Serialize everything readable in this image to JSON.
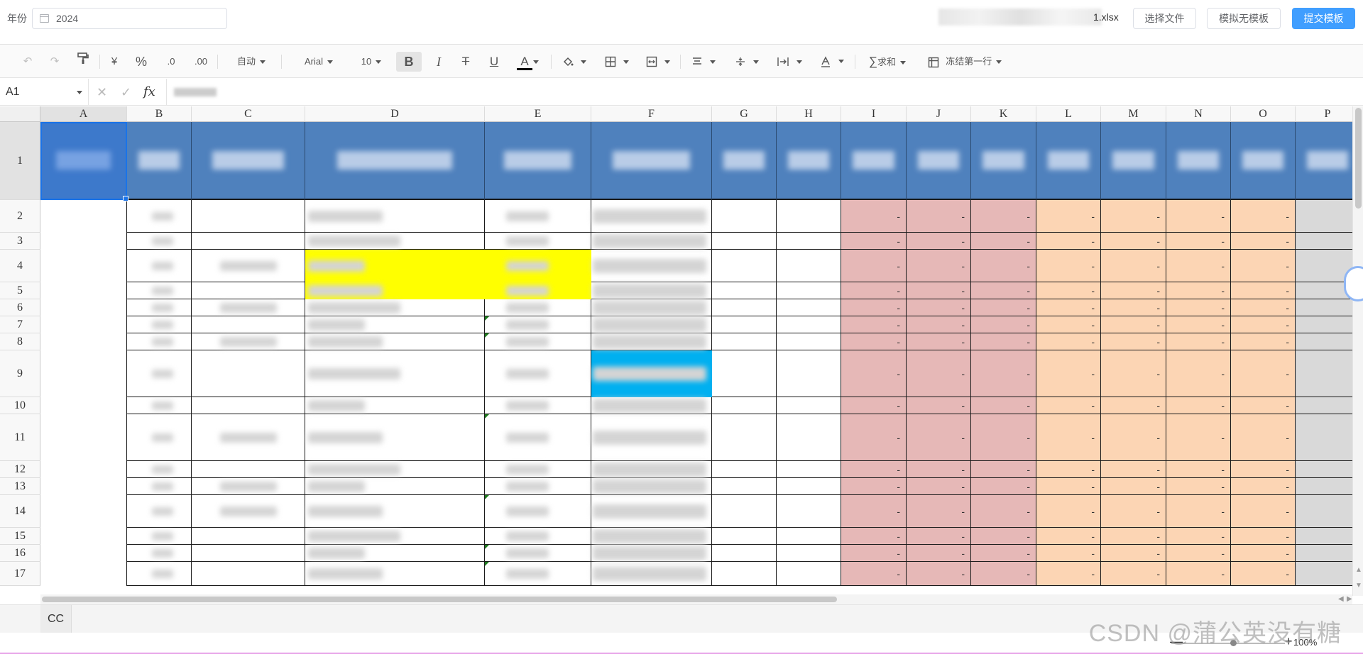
{
  "header": {
    "year_label": "年份",
    "year_value": "2024",
    "filename": "1.xlsx",
    "select_file": "选择文件",
    "download_template": "模拟无模板",
    "submit_template": "提交模板"
  },
  "toolbar": {
    "undo_icon": "undo-icon",
    "redo_icon": "redo-icon",
    "currency": "¥",
    "percent": "%",
    "decimal_dec": ".0",
    "decimal_inc": ".00",
    "format": "自动",
    "font": "Arial",
    "font_size": "10",
    "bold": "B",
    "italic": "I",
    "strike": "T",
    "underline": "U",
    "font_color": "A",
    "text_color_bar": "#000000",
    "sum": "求和",
    "freeze": "冻结第一行"
  },
  "formula_bar": {
    "cell_ref": "A1",
    "fx": "fx"
  },
  "grid": {
    "columns": [
      "A",
      "B",
      "C",
      "D",
      "E",
      "F",
      "G",
      "H",
      "I",
      "J",
      "K",
      "L",
      "M",
      "N",
      "O",
      "P"
    ],
    "rows": [
      "1",
      "2",
      "3",
      "4",
      "5",
      "6",
      "7",
      "8",
      "9",
      "10",
      "11",
      "12",
      "13",
      "14",
      "15",
      "16",
      "17"
    ],
    "dash": "-",
    "colors": {
      "header_blue": "#4f81bd",
      "pink": "#e6b8b7",
      "peach": "#fcd5b4",
      "gray": "#d9d9d9",
      "yellow": "#ffff00",
      "cyan": "#00b0f0"
    }
  },
  "sheets": [
    "CC"
  ],
  "status": {
    "zoom": "100%",
    "minus": "—",
    "plus": "+"
  },
  "watermark": "CSDN @蒲公英没有糖"
}
